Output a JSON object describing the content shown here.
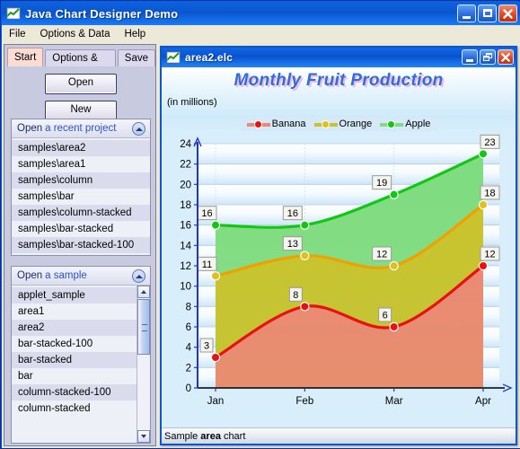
{
  "window": {
    "title": "Java Chart Designer Demo",
    "icon": "chart-icon",
    "controls": [
      {
        "name": "minimize-button",
        "glyph": "minimize"
      },
      {
        "name": "maximize-button",
        "glyph": "maximize"
      },
      {
        "name": "close-button",
        "glyph": "close"
      }
    ]
  },
  "menubar": {
    "items": [
      {
        "label": "File"
      },
      {
        "label": "Options & Data"
      },
      {
        "label": "Help"
      }
    ]
  },
  "sidebar": {
    "tabs": [
      {
        "label": "Start",
        "active": true
      },
      {
        "label": "Options & Data",
        "active": false
      },
      {
        "label": "Save",
        "active": false
      }
    ],
    "buttons": [
      {
        "label": "Open"
      },
      {
        "label": "New"
      }
    ],
    "recent_group": {
      "title_plain": "Open",
      "title_link": "a recent project",
      "collapse_icon": "chevron-up-icon",
      "items": [
        "samples\\area2",
        "samples\\area1",
        "samples\\column",
        "samples\\bar",
        "samples\\column-stacked",
        "samples\\bar-stacked",
        "samples\\bar-stacked-100"
      ]
    },
    "sample_group": {
      "title_plain": "Open",
      "title_link": "a sample",
      "collapse_icon": "chevron-up-icon",
      "items": [
        "applet_sample",
        "area1",
        "area2",
        "bar-stacked-100",
        "bar-stacked",
        "bar",
        "column-stacked-100",
        "column-stacked"
      ]
    }
  },
  "chart_window": {
    "title": "area2.elc",
    "icon": "chart-icon",
    "controls": [
      {
        "name": "minimize-button",
        "glyph": "minimize"
      },
      {
        "name": "restore-button",
        "glyph": "restore"
      },
      {
        "name": "close-button",
        "glyph": "close"
      }
    ],
    "status": {
      "prefix": "Sample",
      "bold": "area",
      "suffix": "chart"
    }
  },
  "chart_data": {
    "type": "area",
    "title": "Monthly Fruit Production",
    "subtitle": "(in millions)",
    "xlabel": "",
    "ylabel": "",
    "categories": [
      "Jan",
      "Feb",
      "Mar",
      "Apr"
    ],
    "ylim": [
      0,
      24
    ],
    "ytick_step": 2,
    "yticks": [
      0,
      2,
      4,
      6,
      8,
      10,
      12,
      14,
      16,
      18,
      20,
      22,
      24
    ],
    "grid": true,
    "legend_position": "top-center",
    "stacked": false,
    "series": [
      {
        "name": "Banana",
        "values": [
          3,
          8,
          6,
          12
        ],
        "color": "#e81010",
        "fill": "#ea8a74",
        "marker": "circle"
      },
      {
        "name": "Orange",
        "values": [
          11,
          13,
          12,
          18
        ],
        "color": "#f0a000",
        "fill": "#c9c32e",
        "marker": "circle",
        "marker_color": "#e0c020"
      },
      {
        "name": "Apple",
        "values": [
          16,
          16,
          19,
          23
        ],
        "color": "#12c612",
        "fill": "#7fdc7f",
        "marker": "circle"
      }
    ]
  }
}
